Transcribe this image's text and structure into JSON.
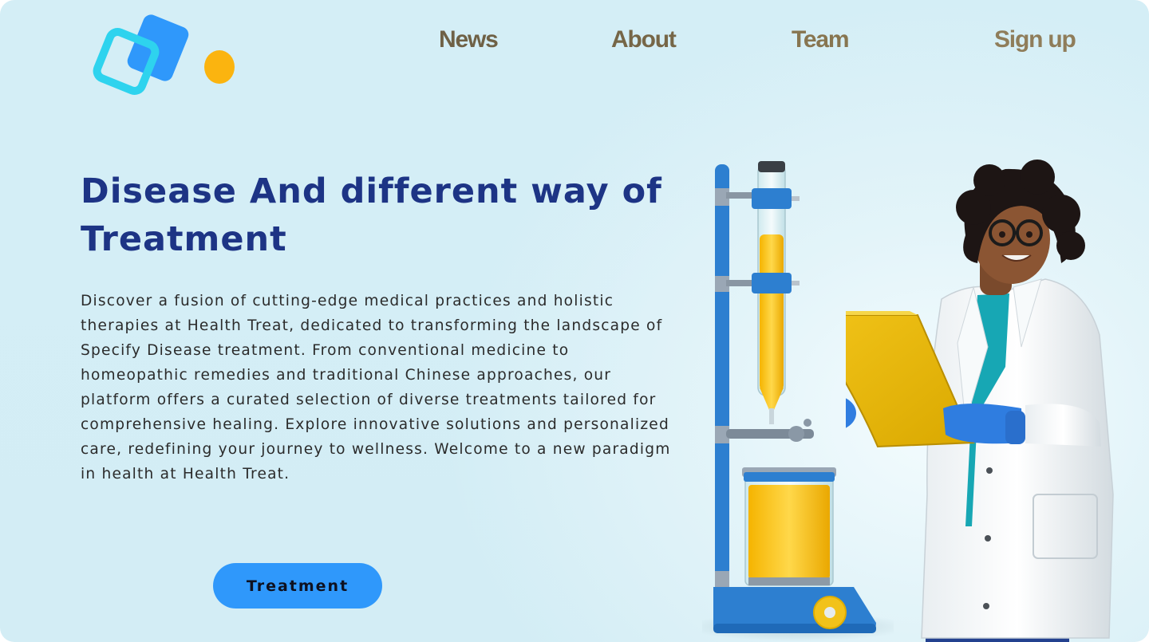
{
  "nav": {
    "items": [
      {
        "label": "News"
      },
      {
        "label": "About"
      },
      {
        "label": "Team"
      },
      {
        "label": "Sign up"
      }
    ]
  },
  "hero": {
    "headline": "Disease And different way of Treatment",
    "description": "Discover a fusion of cutting-edge medical practices and holistic therapies at Health Treat, dedicated to transforming the landscape of Specify Disease treatment. From conventional medicine to homeopathic remedies and traditional Chinese approaches, our platform offers a curated selection of diverse treatments tailored for comprehensive healing. Explore innovative solutions and personalized care, redefining your journey to wellness. Welcome to a new paradigm in health at Health Treat.",
    "cta_label": "Treatment"
  },
  "colors": {
    "background": "#d4eef6",
    "headline": "#1d3485",
    "nav_text": "#7d6a4a",
    "button": "#2f98fb",
    "logo_blue": "#2f98fb",
    "logo_cyan": "#2ed3ee",
    "logo_dot": "#fbb40f"
  },
  "icons": {
    "logo": "overlapping-squares-logo",
    "lab_apparatus": "chromatography-column-illustration",
    "doctor": "doctor-with-clipboard-illustration"
  }
}
